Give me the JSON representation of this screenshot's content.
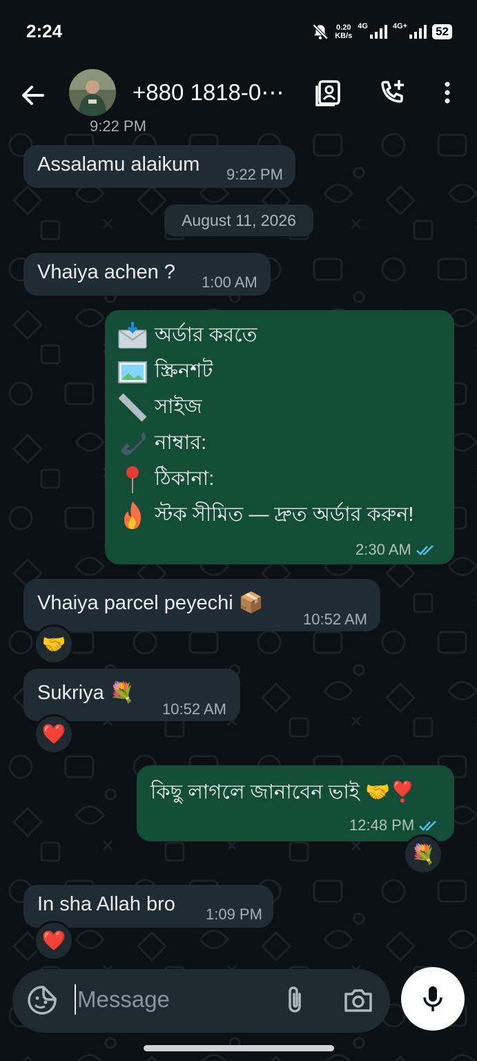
{
  "status_bar": {
    "time": "2:24",
    "net_speed_value": "0.20",
    "net_speed_unit": "KB/s",
    "sim1": "4G",
    "sim2": "4G+",
    "battery": "52"
  },
  "header": {
    "contact_name": "+880 1818-0⋯"
  },
  "chat": {
    "partial_time": "9:22 PM",
    "messages": [
      {
        "dir": "in",
        "text": "Assalamu alaikum",
        "time": "9:22 PM"
      },
      {
        "dir": "in",
        "text": "Vhaiya achen ?",
        "time": "1:00 AM"
      },
      {
        "dir": "out",
        "time": "2:30 AM",
        "lines": [
          {
            "icon": "envelope-icon",
            "text": "অর্ডার করতে"
          },
          {
            "icon": "picture-icon",
            "text": "স্ক্রিনশট"
          },
          {
            "icon": "ruler-icon",
            "text": "সাইজ"
          },
          {
            "icon": "phone-icon",
            "text": "নাম্বার:"
          },
          {
            "icon": "pin-icon",
            "text": "ঠিকানা:"
          },
          {
            "icon": "fire-icon",
            "text": "স্টক সীমিত — দ্রুত অর্ডার করুন!"
          }
        ]
      },
      {
        "dir": "in",
        "text": "Vhaiya parcel peyechi",
        "emoji": "📦",
        "time": "10:52 AM",
        "reaction": "🤝"
      },
      {
        "dir": "in",
        "text": "Sukriya",
        "emoji": "💐",
        "time": "10:52 AM",
        "reaction": "❤️"
      },
      {
        "dir": "out",
        "text": "কিছু লাগলে জানাবেন ভাই",
        "emoji": "🤝❣️",
        "time": "12:48 PM",
        "reaction": "💐"
      },
      {
        "dir": "in",
        "text": "In sha Allah bro",
        "time": "1:09 PM",
        "reaction": "❤️"
      }
    ],
    "date_separator": "August 11, 2026"
  },
  "composer": {
    "placeholder": "Message"
  },
  "colors": {
    "background": "#0b1014",
    "incoming_bubble": "#202c33",
    "outgoing_bubble": "#144d37",
    "read_ticks": "#53bdeb"
  }
}
